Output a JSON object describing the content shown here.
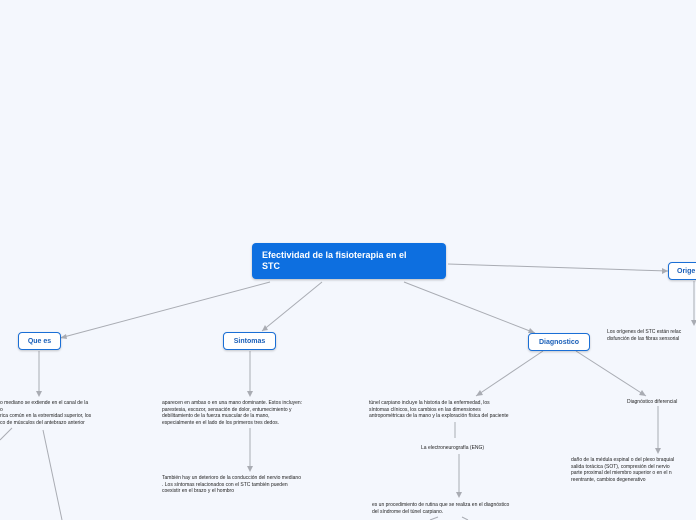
{
  "root": {
    "title_line1": "Efectividad de la fisioterapia en el",
    "title_line2": "STC"
  },
  "topics": {
    "que_es": "Que es",
    "sintomas": "Sintomas",
    "diagnostico": "Diagnostico",
    "origenes": "Orige"
  },
  "que_es": {
    "lines": [
      "o mediano se extiende en el canal de la",
      "o",
      "rica común en la extremidad superior, los",
      "co de músculos del antebrazo anterior"
    ]
  },
  "sintomas": {
    "p1": [
      "aparecen en ambas o en una mano dominante. Estos incluyen:",
      "parestesia, escozor, sensación de dolor, entumecimiento y",
      "debilitamiento de la fuerza muscular de la mano,",
      "especialmente en el lado de los primeros tres dedos."
    ],
    "p2": [
      "También hay un deterioro de la conducción del nervio mediano",
      ". Los síntomas  relacionados con el STC también pueden",
      "coexistir en el brazo y el hombro"
    ]
  },
  "diagnostico": {
    "p1": [
      "túnel carpiano incluye la historia de la enfermedad, los",
      "síntomas clínicos, los cambios en las dimensiones",
      "antropométricas de la mano y la exploración física del paciente"
    ],
    "eng": "La electroneurografía (ENG)",
    "p2": [
      "es un procedimiento de rutina que se realiza en el diagnóstico",
      "del síndrome del túnel carpiano."
    ],
    "diferencial": "Diagnóstico diferencial",
    "p3": [
      "daño de la médula espinal o del plexo braquial",
      "salida torácica (SOT), compresión del nervio",
      "parte proximal del miembro superior o en el n",
      "reentrante, cambios degenerativo"
    ]
  },
  "origenes": {
    "lines": [
      "Los orígenes del STC están relac",
      "disfunción de las fibras sensorial"
    ]
  },
  "colors": {
    "root_bg": "#0d6fe0",
    "node_border": "#1a6fd6",
    "link": "#a9acb3",
    "background": "#f4f7fd"
  }
}
